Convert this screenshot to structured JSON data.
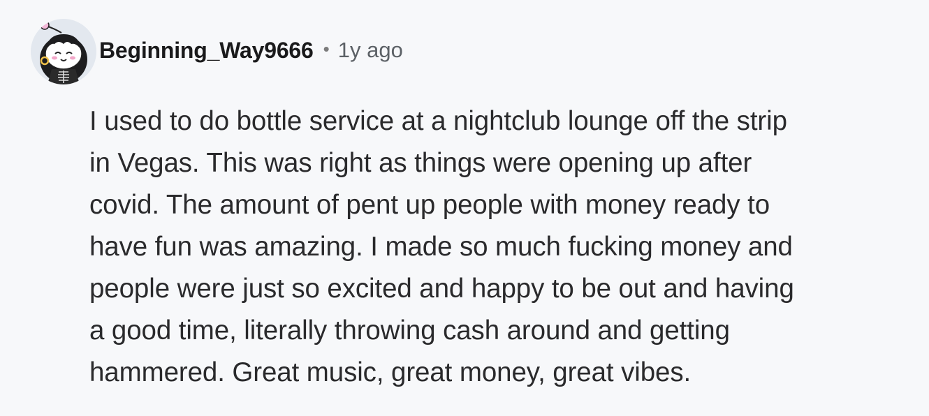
{
  "comment": {
    "author": "Beginning_Way9666",
    "separator": "•",
    "timestamp": "1y ago",
    "avatar_icon": "snoo-avatar-icon",
    "body_lines": [
      "I used to do bottle service at a nightclub lounge off the strip",
      "in Vegas. This was right as things were opening up after",
      "covid. The amount of pent up people with money ready to",
      "have fun was amazing. I made so much fucking money and",
      "people were just so excited and happy to be out and having",
      "a good time, literally throwing cash around and getting",
      "hammered. Great music, great money, great vibes."
    ]
  },
  "colors": {
    "background": "#f7f8fa",
    "username": "#1a1a1b",
    "timestamp": "#5c6166",
    "body": "#2a2a2c"
  }
}
